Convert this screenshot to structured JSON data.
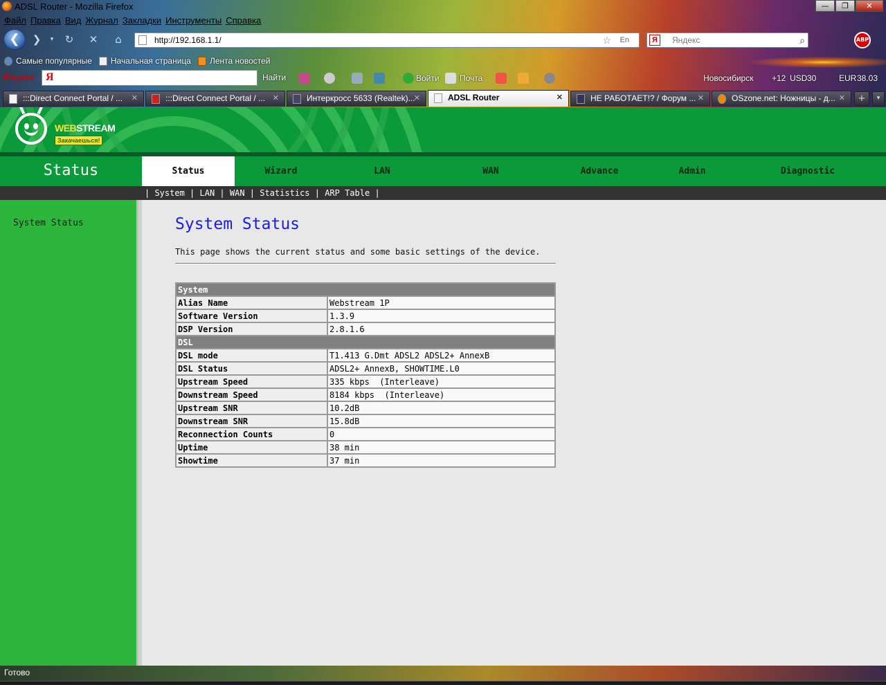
{
  "browser": {
    "window_title": "ADSL Router - Mozilla Firefox",
    "menu": [
      "Файл",
      "Правка",
      "Вид",
      "Журнал",
      "Закладки",
      "Инструменты",
      "Справка"
    ],
    "url": "http://192.168.1.1/",
    "url_lang": "En",
    "search_placeholder": "Яндекс",
    "bookmarks": [
      "Самые популярные",
      "Начальная страница",
      "Лента новостей"
    ],
    "yandex_bar": {
      "logo": "Яндекс",
      "find_label": "Найти",
      "login_label": "Войти",
      "mail_label": "Почта",
      "city": "Новосибирск",
      "temp": "+12",
      "usd_label": "USD",
      "usd_value": "30",
      "eur_label": "EUR",
      "eur_value": "38.03"
    },
    "tabs": [
      {
        "label": ":::Direct Connect Portal / ...",
        "active": false
      },
      {
        "label": ":::Direct Connect Portal / ...",
        "active": false
      },
      {
        "label": "Интеркросс 5633 (Realtek)...",
        "active": false
      },
      {
        "label": "ADSL Router",
        "active": true
      },
      {
        "label": "НЕ РАБОТАЕТ!? / Форум ...",
        "active": false
      },
      {
        "label": "OSzone.net: Ножницы - д...",
        "active": false
      }
    ],
    "status_text": "Готово"
  },
  "router": {
    "logo_text_web": "WEB",
    "logo_text_stream": "STREAM",
    "logo_tagline": "Закачаешься!",
    "section_title": "Status",
    "nav_tabs": [
      "Status",
      "Wizard",
      "LAN",
      "WAN",
      "Advance",
      "Admin",
      "Diagnostic"
    ],
    "active_tab": "Status",
    "sub_nav": [
      "System",
      "LAN",
      "WAN",
      "Statistics",
      "ARP Table"
    ],
    "sidebar": [
      "System Status"
    ],
    "page_title": "System Status",
    "page_desc": "This page shows the current status and some basic settings of the device.",
    "sections": [
      {
        "header": "System",
        "rows": [
          {
            "key": "Alias Name",
            "value": "Webstream 1P"
          },
          {
            "key": "Software Version",
            "value": "1.3.9"
          },
          {
            "key": "DSP Version",
            "value": "2.8.1.6"
          }
        ]
      },
      {
        "header": "DSL",
        "rows": [
          {
            "key": "DSL mode",
            "value": "T1.413 G.Dmt ADSL2 ADSL2+ AnnexB"
          },
          {
            "key": "DSL Status",
            "value": "ADSL2+ AnnexB, SHOWTIME.L0"
          },
          {
            "key": "Upstream Speed",
            "value": "335 kbps  (Interleave)"
          },
          {
            "key": "Downstream Speed",
            "value": "8184 kbps  (Interleave)"
          },
          {
            "key": "Upstream SNR",
            "value": "10.2dB"
          },
          {
            "key": "Downstream SNR",
            "value": "15.8dB"
          },
          {
            "key": "Reconnection Counts",
            "value": "0"
          },
          {
            "key": "Uptime",
            "value": "38 min"
          },
          {
            "key": "Showtime",
            "value": "37 min"
          }
        ]
      }
    ]
  }
}
